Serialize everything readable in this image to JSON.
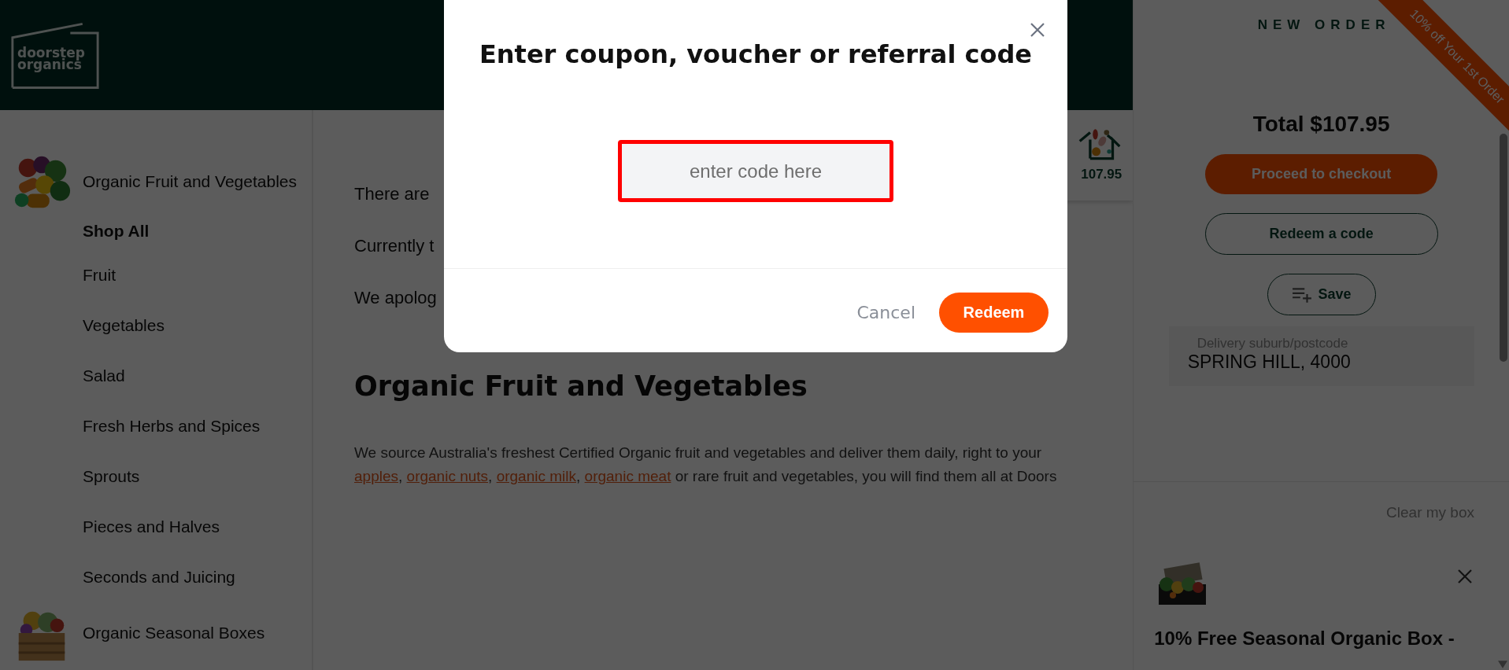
{
  "header": {
    "logo_lines": [
      "doorstep",
      "organics"
    ]
  },
  "sidebar": {
    "categories": [
      {
        "label": "Organic Fruit and Vegetables",
        "kind": "picture",
        "children": [
          {
            "label": "Shop All",
            "selected": true
          },
          {
            "label": "Fruit",
            "selected": false
          },
          {
            "label": "Vegetables",
            "selected": false
          },
          {
            "label": "Salad",
            "selected": false
          },
          {
            "label": "Fresh Herbs and Spices",
            "selected": false
          },
          {
            "label": "Sprouts",
            "selected": false
          },
          {
            "label": "Pieces and Halves",
            "selected": false
          },
          {
            "label": "Seconds and Juicing",
            "selected": false
          }
        ]
      },
      {
        "label": "Organic Seasonal Boxes",
        "kind": "picture"
      }
    ]
  },
  "main": {
    "notices": [
      "There are",
      "Currently t",
      "We apolog"
    ],
    "heading": "Organic Fruit and Vegetables",
    "description": [
      [
        {
          "text": "We source Australia's freshest Certified Organic fruit and vegetables and deliver them daily, right to your",
          "link": false
        }
      ],
      [
        {
          "text": "apples",
          "link": true
        },
        {
          "text": ", ",
          "link": false
        },
        {
          "text": "organic nuts",
          "link": true
        },
        {
          "text": ", ",
          "link": false
        },
        {
          "text": "organic milk",
          "link": true
        },
        {
          "text": ", ",
          "link": false
        },
        {
          "text": "organic meat",
          "link": true
        },
        {
          "text": " or rare fruit and vegetables, you will find them all at Doors",
          "link": false
        }
      ]
    ]
  },
  "cart_tile": {
    "amount": "107.95"
  },
  "order_panel": {
    "title": "NEW ORDER",
    "ribbon": "10% off Your 1st Order",
    "total": "Total $107.95",
    "buttons": [
      {
        "label": "Proceed to checkout",
        "kind": "primary"
      },
      {
        "label": "Redeem a code",
        "kind": "outline"
      },
      {
        "label": "Save",
        "kind": "save"
      }
    ],
    "delivery": {
      "label": "Delivery suburb/postcode",
      "value": "SPRING HILL, 4000"
    },
    "clear_label": "Clear my box",
    "items": [
      {
        "title": "10% Free Seasonal Organic Box -"
      }
    ]
  },
  "modal": {
    "title": "Enter coupon, voucher or referral code",
    "input": {
      "placeholder": "enter code here"
    },
    "cancel": "Cancel",
    "submit": "Redeem"
  }
}
